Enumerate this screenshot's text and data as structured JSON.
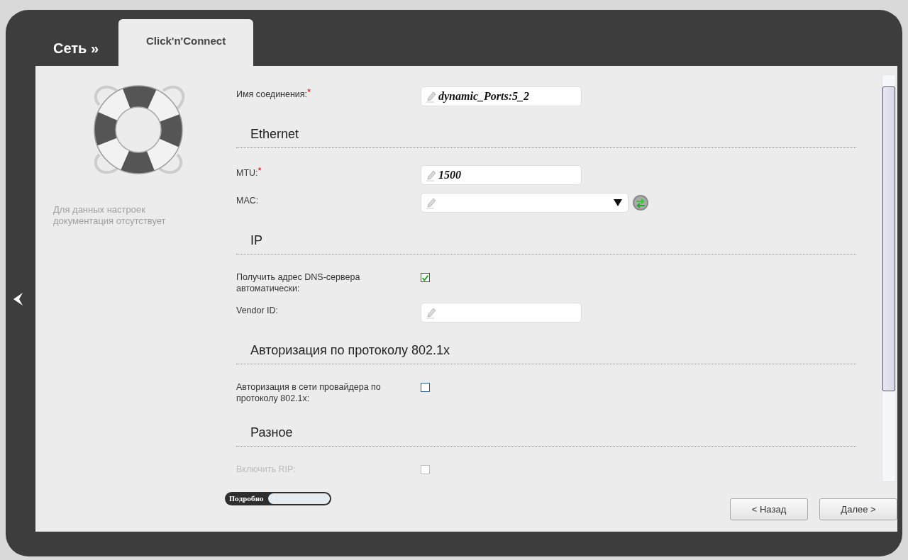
{
  "breadcrumb": "Сеть »",
  "tabs": [
    {
      "label": "Click'n'Connect",
      "selected": true
    }
  ],
  "help": {
    "text": "Для данных настроек документация отсутствует"
  },
  "sections": [
    {
      "fields": [
        {
          "kind": "text",
          "label": "Имя соединения:",
          "required_mark": "*",
          "value": "dynamic_Ports:5_2"
        }
      ]
    },
    {
      "title": "Ethernet",
      "fields": [
        {
          "kind": "text",
          "label": "MTU:",
          "required_mark": "*",
          "value": "1500"
        },
        {
          "kind": "select",
          "label": "MAC:"
        }
      ]
    },
    {
      "title": "IP",
      "fields": [
        {
          "kind": "checkbox",
          "label": "Получить адрес DNS-сервера автоматически:",
          "checked": true,
          "disabled": false
        },
        {
          "kind": "text",
          "label": "Vendor ID:"
        }
      ]
    },
    {
      "title": "Авторизация по протоколу 802.1x",
      "fields": [
        {
          "kind": "checkbox",
          "label": "Авторизация в сети провайдера по протоколу 802.1x:",
          "checked": false,
          "disabled": false
        }
      ]
    },
    {
      "title": "Разное",
      "fields": [
        {
          "kind": "checkbox",
          "label": "Включить RIP:",
          "checked": false,
          "disabled": true
        }
      ]
    }
  ],
  "details_toggle": {
    "label": "Подробно"
  },
  "buttons": [
    "< Назад",
    "Далее >"
  ]
}
